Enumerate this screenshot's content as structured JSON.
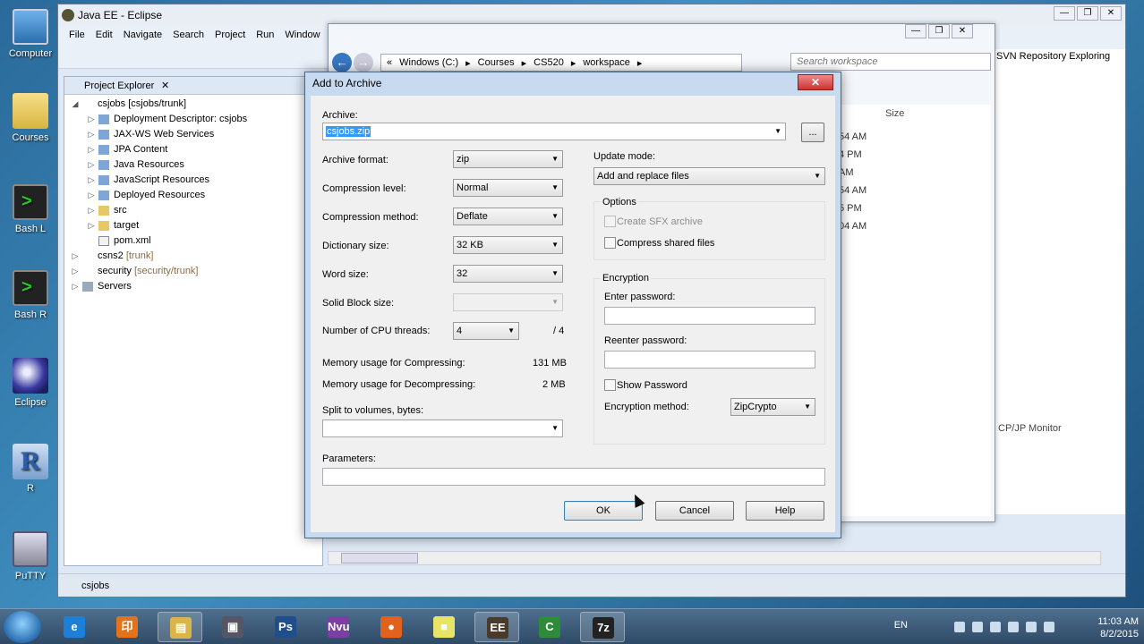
{
  "desktop": {
    "icons": [
      {
        "label": "Computer",
        "icon": "computer-icon"
      },
      {
        "label": "Courses",
        "icon": "folder-icon"
      },
      {
        "label": "Bash L",
        "icon": "terminal-icon"
      },
      {
        "label": "Bash R",
        "icon": "terminal-icon"
      },
      {
        "label": "Eclipse",
        "icon": "eclipse-icon"
      },
      {
        "label": "R",
        "icon": "r-icon"
      },
      {
        "label": "PuTTY",
        "icon": "putty-icon"
      }
    ]
  },
  "eclipse": {
    "title": "Java EE - Eclipse",
    "menu": [
      "File",
      "Edit",
      "Navigate",
      "Search",
      "Project",
      "Run",
      "Window"
    ],
    "project_explorer": {
      "title": "Project Explorer",
      "tree": [
        {
          "text": "csjobs [csjobs/trunk]",
          "level": 0,
          "expanded": true,
          "icon": "project"
        },
        {
          "text": "Deployment Descriptor: csjobs",
          "level": 1,
          "icon": "blue"
        },
        {
          "text": "JAX-WS Web Services",
          "level": 1,
          "icon": "blue"
        },
        {
          "text": "JPA Content",
          "level": 1,
          "icon": "blue"
        },
        {
          "text": "Java Resources",
          "level": 1,
          "icon": "blue"
        },
        {
          "text": "JavaScript Resources",
          "level": 1,
          "icon": "blue"
        },
        {
          "text": "Deployed Resources",
          "level": 1,
          "icon": "blue"
        },
        {
          "text": "src",
          "level": 1,
          "icon": "folder"
        },
        {
          "text": "target",
          "level": 1,
          "icon": "folder"
        },
        {
          "text": "pom.xml",
          "level": 1,
          "icon": "file",
          "no_toggle": true
        },
        {
          "text": "csns2",
          "suffix": "[trunk]",
          "level": 0,
          "icon": "project"
        },
        {
          "text": "security",
          "suffix": "[security/trunk]",
          "level": 0,
          "icon": "project"
        },
        {
          "text": "Servers",
          "level": 0,
          "icon": "server"
        }
      ]
    },
    "svn_panel": "SVN Repository Exploring",
    "tcp_panel": "CP/JP Monitor",
    "status_text": "csjobs"
  },
  "explorer_window": {
    "breadcrumb": [
      "Windows (C:)",
      "Courses",
      "CS520",
      "workspace"
    ],
    "search_placeholder": "Search workspace",
    "size_header": "Size",
    "times": [
      "54 AM",
      "4 PM",
      "AM",
      "54 AM",
      "5 PM",
      "04 AM"
    ]
  },
  "dialog": {
    "title": "Add to Archive",
    "archive_label": "Archive:",
    "archive_value": "csjobs.zip",
    "browse_label": "...",
    "archive_format_label": "Archive format:",
    "archive_format_value": "zip",
    "compression_level_label": "Compression level:",
    "compression_level_value": "Normal",
    "compression_method_label": "Compression method:",
    "compression_method_value": "Deflate",
    "dictionary_size_label": "Dictionary size:",
    "dictionary_size_value": "32 KB",
    "word_size_label": "Word size:",
    "word_size_value": "32",
    "solid_block_label": "Solid Block size:",
    "solid_block_value": "",
    "cpu_threads_label": "Number of CPU threads:",
    "cpu_threads_value": "4",
    "cpu_threads_total": "/ 4",
    "mem_compress_label": "Memory usage for Compressing:",
    "mem_compress_value": "131 MB",
    "mem_decompress_label": "Memory usage for Decompressing:",
    "mem_decompress_value": "2 MB",
    "split_label": "Split to volumes, bytes:",
    "split_value": "",
    "parameters_label": "Parameters:",
    "parameters_value": "",
    "update_mode_label": "Update mode:",
    "update_mode_value": "Add and replace files",
    "options_label": "Options",
    "sfx_label": "Create SFX archive",
    "compress_shared_label": "Compress shared files",
    "encryption_label": "Encryption",
    "enter_password_label": "Enter password:",
    "reenter_password_label": "Reenter password:",
    "show_password_label": "Show Password",
    "encryption_method_label": "Encryption method:",
    "encryption_method_value": "ZipCrypto",
    "ok_label": "OK",
    "cancel_label": "Cancel",
    "help_label": "Help"
  },
  "taskbar": {
    "items": [
      {
        "name": "internet-explorer",
        "glyph": "e",
        "color": "#1e7fd6"
      },
      {
        "name": "app-orange",
        "glyph": "印",
        "color": "#e2731a"
      },
      {
        "name": "file-explorer",
        "glyph": "▤",
        "color": "#d9b54a",
        "active": true
      },
      {
        "name": "security-app",
        "glyph": "▣",
        "color": "#556"
      },
      {
        "name": "photoshop",
        "glyph": "Ps",
        "color": "#1f4e8c"
      },
      {
        "name": "nvu",
        "glyph": "Nvu",
        "color": "#7a3fa0"
      },
      {
        "name": "firefox",
        "glyph": "●",
        "color": "#e0621c"
      },
      {
        "name": "sticky-notes",
        "glyph": "■",
        "color": "#e8e46a"
      },
      {
        "name": "java-ee-ide",
        "glyph": "EE",
        "color": "#4a3a2a",
        "active": true
      },
      {
        "name": "camtasia",
        "glyph": "C",
        "color": "#2e8b3a"
      },
      {
        "name": "7zip",
        "glyph": "7z",
        "color": "#222",
        "active": true
      }
    ],
    "language": "EN",
    "time": "11:03 AM",
    "date": "8/2/2015"
  }
}
